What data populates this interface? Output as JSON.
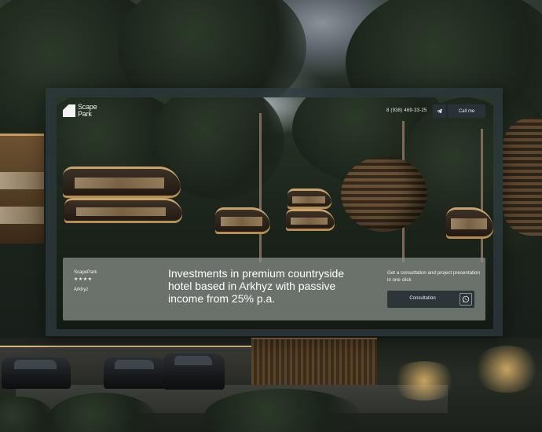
{
  "brand": {
    "logo_line1": "Scape",
    "logo_line2": "Park"
  },
  "header": {
    "phone": "8 (938) 469-33-25",
    "telegram_icon": "telegram-icon",
    "call_label": "Call me"
  },
  "card": {
    "brand_name": "ScapePark",
    "stars": "★★★★",
    "location": "Arkhyz",
    "headline": "Investments in premium countryside hotel  based in Arkhyz with passive income from 25% p.a.",
    "cta_text": "Get a consultation and project presentation in one click",
    "consult_label": "Consultation",
    "whatsapp_icon": "whatsapp-icon"
  },
  "colors": {
    "button_bg": "#2c3639",
    "card_bg": "#8c928c",
    "frame_bg": "#2d383c",
    "text": "#ffffff"
  }
}
